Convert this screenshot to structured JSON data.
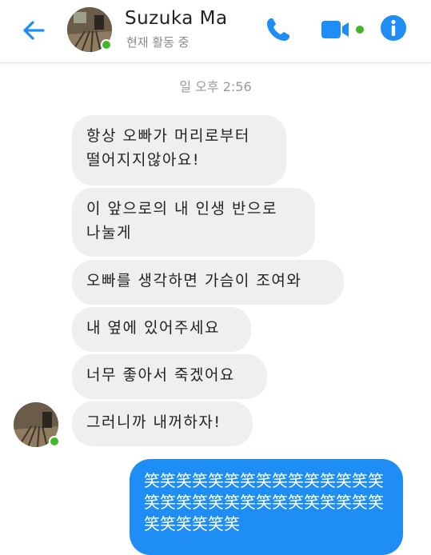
{
  "header": {
    "contact_name": "Suzuka Ma",
    "status": "현재 활동 중",
    "accent_color": "#1e8ef6",
    "online_color": "#42b72a",
    "icons": [
      "back-arrow-icon",
      "phone-icon",
      "video-camera-icon",
      "info-icon"
    ]
  },
  "conversation": {
    "timestamp": "일 오후 2:56",
    "received": [
      {
        "line1": "항상 오빠가 머리로부터",
        "line2": "떨어지지않아요!"
      },
      {
        "line1": "이 앞으로의 내 인생 반으로",
        "line2": "나눌게"
      },
      {
        "text": "오빠를 생각하면 가슴이 조여와"
      },
      {
        "text": "내 옆에 있어주세요"
      },
      {
        "text": "너무 좋아서 죽겠어요"
      },
      {
        "text": "그러니까 내꺼하자!"
      }
    ],
    "sent": {
      "text": "笑笑笑笑笑笑笑笑笑笑笑笑笑笑笑笑笑笑笑笑笑笑笑笑笑笑笑笑笑笑笑笑笑笑笑笑"
    }
  }
}
